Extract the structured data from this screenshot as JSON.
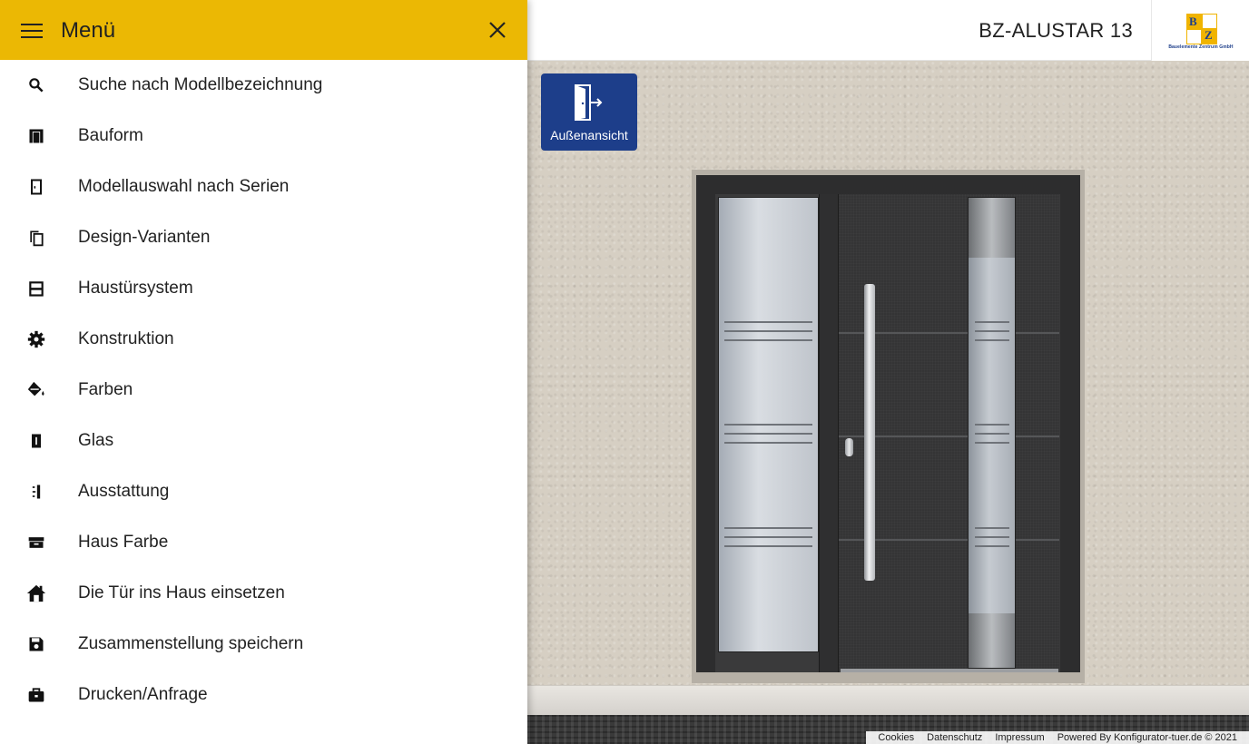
{
  "header": {
    "model_title": "BZ-ALUSTAR 13"
  },
  "logo": {
    "letter_1": "B",
    "letter_2": "Z",
    "caption": "Bauelemente Zentrum GmbH"
  },
  "view_button": {
    "label": "Außenansicht",
    "icon": "door-exit-icon"
  },
  "drawer": {
    "title": "Menü",
    "items": [
      {
        "label": "Suche nach Modellbezeichnung",
        "icon": "search-icon"
      },
      {
        "label": "Bauform",
        "icon": "door-frame-icon"
      },
      {
        "label": "Modellauswahl nach Serien",
        "icon": "door-outline-icon"
      },
      {
        "label": "Design-Varianten",
        "icon": "copy-icon"
      },
      {
        "label": "Haustürsystem",
        "icon": "door-system-icon"
      },
      {
        "label": "Konstruktion",
        "icon": "gear-icon"
      },
      {
        "label": "Farben",
        "icon": "paint-bucket-icon"
      },
      {
        "label": "Glas",
        "icon": "glass-icon"
      },
      {
        "label": "Ausstattung",
        "icon": "handle-icon"
      },
      {
        "label": "Haus Farbe",
        "icon": "house-color-icon"
      },
      {
        "label": "Die Tür ins Haus einsetzen",
        "icon": "home-icon"
      },
      {
        "label": "Zusammenstellung speichern",
        "icon": "save-icon"
      },
      {
        "label": "Drucken/Anfrage",
        "icon": "briefcase-icon"
      }
    ]
  },
  "footer": {
    "links": [
      "Cookies",
      "Datenschutz",
      "Impressum",
      "Powered By Konfigurator-tuer.de © 2021"
    ]
  },
  "colors": {
    "drawer_header": "#ebb804",
    "accent_blue": "#1d3e8a",
    "door": "#343435"
  }
}
